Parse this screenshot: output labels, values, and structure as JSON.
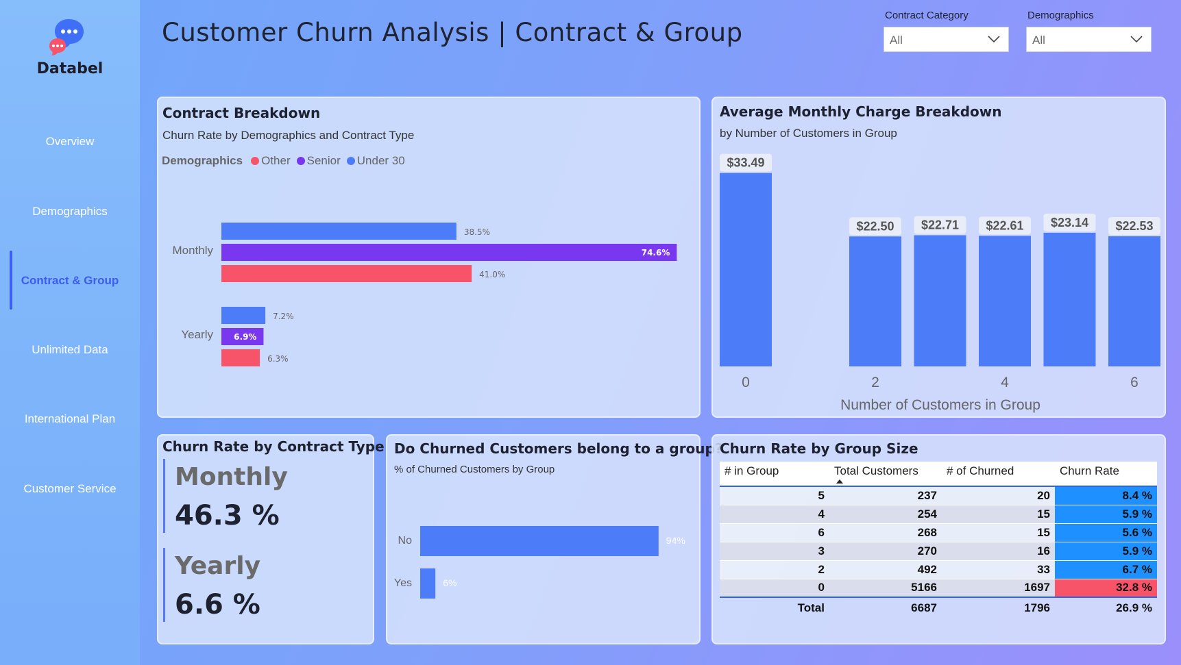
{
  "brand": {
    "name": "Databel"
  },
  "nav": {
    "items": [
      {
        "label": "Overview"
      },
      {
        "label": "Demographics"
      },
      {
        "label": "Contract & Group"
      },
      {
        "label": "Unlimited Data"
      },
      {
        "label": "International Plan"
      },
      {
        "label": "Customer Service"
      }
    ],
    "active": "Contract & Group"
  },
  "header": {
    "title": "Customer Churn Analysis | Contract & Group"
  },
  "filters": {
    "contract_category": {
      "label": "Contract Category",
      "value": "All"
    },
    "demographics": {
      "label": "Demographics",
      "value": "All"
    }
  },
  "colors": {
    "other": "#f7546a",
    "senior": "#7a37f0",
    "under30": "#4d7cf9",
    "bar": "#4d7cf9",
    "highlight_low": "#1e90ff",
    "highlight_high": "#f7546a"
  },
  "contract_breakdown": {
    "title": "Contract Breakdown",
    "subtitle": "Churn Rate by Demographics and Contract Type",
    "legend_title": "Demographics",
    "legend": [
      "Other",
      "Senior",
      "Under 30"
    ]
  },
  "avg_monthly": {
    "title": "Average Monthly Charge Breakdown",
    "subtitle": "by Number of Customers in Group",
    "xlabel": "Number of Customers in Group"
  },
  "kpi": {
    "title": "Churn Rate by Contract Type",
    "monthly_label": "Monthly",
    "monthly_value": "46.3 %",
    "yearly_label": "Yearly",
    "yearly_value": "6.6 %"
  },
  "group_question": {
    "title": "Do Churned Customers belong to a group?",
    "subtitle": "% of Churned Customers by Group"
  },
  "group_table": {
    "title": "Churn Rate by Group Size",
    "headers": [
      "# in Group",
      "Total Customers",
      "# of Churned",
      "Churn Rate"
    ],
    "rows": [
      {
        "group": "5",
        "total": "237",
        "churned": "20",
        "rate": "8.4 %"
      },
      {
        "group": "4",
        "total": "254",
        "churned": "15",
        "rate": "5.9 %"
      },
      {
        "group": "6",
        "total": "268",
        "churned": "15",
        "rate": "5.6 %"
      },
      {
        "group": "3",
        "total": "270",
        "churned": "16",
        "rate": "5.9 %"
      },
      {
        "group": "2",
        "total": "492",
        "churned": "33",
        "rate": "6.7 %"
      },
      {
        "group": "0",
        "total": "5166",
        "churned": "1697",
        "rate": "32.8 %"
      }
    ],
    "total": {
      "label": "Total",
      "total": "6687",
      "churned": "1796",
      "rate": "26.9 %"
    }
  },
  "chart_data": [
    {
      "type": "bar",
      "orientation": "horizontal",
      "title": "Contract Breakdown",
      "subtitle": "Churn Rate by Demographics and Contract Type",
      "categories": [
        "Monthly",
        "Yearly"
      ],
      "series": [
        {
          "name": "Under 30",
          "values": [
            38.5,
            7.2
          ],
          "labels": [
            "38.5%",
            "7.2%"
          ]
        },
        {
          "name": "Senior",
          "values": [
            74.6,
            6.9
          ],
          "labels": [
            "74.6%",
            "6.9%"
          ]
        },
        {
          "name": "Other",
          "values": [
            41.0,
            6.3
          ],
          "labels": [
            "41.0%",
            "6.3%"
          ]
        }
      ],
      "xlim": [
        0,
        85
      ]
    },
    {
      "type": "bar",
      "title": "Average Monthly Charge Breakdown",
      "subtitle": "by Number of Customers in Group",
      "xlabel": "Number of Customers in Group",
      "categories": [
        "0",
        "2",
        "3",
        "4",
        "5",
        "6"
      ],
      "tick_labels": [
        "0",
        "2",
        "4",
        "6"
      ],
      "values": [
        33.49,
        22.5,
        22.71,
        22.61,
        23.14,
        22.53
      ],
      "labels": [
        "$33.49",
        "$22.50",
        "$22.71",
        "$22.61",
        "$23.14",
        "$22.53"
      ],
      "ylim": [
        0,
        37
      ]
    },
    {
      "type": "bar",
      "orientation": "horizontal",
      "title": "Do Churned Customers belong to a group?",
      "subtitle": "% of Churned Customers by Group",
      "categories": [
        "No",
        "Yes"
      ],
      "values": [
        94,
        6
      ],
      "labels": [
        "94%",
        "6%"
      ],
      "xlim": [
        0,
        100
      ]
    }
  ]
}
